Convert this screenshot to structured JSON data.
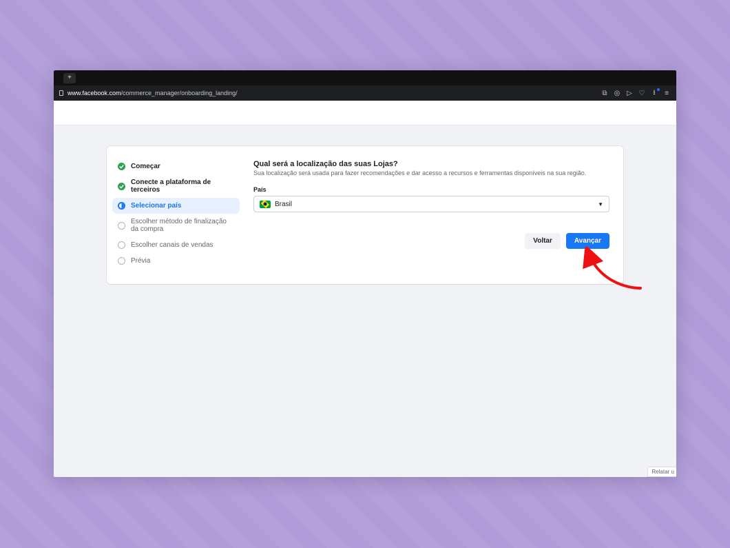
{
  "url": {
    "domain": "www.facebook.com",
    "path": "/commerce_manager/onboarding_landing/"
  },
  "toolbar_icons": [
    "new-tab-icon"
  ],
  "addr_icons": [
    "save-icon",
    "camera-icon",
    "send-icon",
    "heart-icon",
    "download-icon",
    "menu-icon"
  ],
  "steps": [
    {
      "label": "Começar",
      "state": "done"
    },
    {
      "label": "Conecte a plataforma de terceiros",
      "state": "done"
    },
    {
      "label": "Selecionar país",
      "state": "active"
    },
    {
      "label": "Escolher método de finalização da compra",
      "state": "upcoming"
    },
    {
      "label": "Escolher canais de vendas",
      "state": "upcoming"
    },
    {
      "label": "Prévia",
      "state": "upcoming"
    }
  ],
  "heading": "Qual será a localização das suas Lojas?",
  "subheading": "Sua localização será usada para fazer recomendações e dar acesso a recursos e ferramentas disponíveis na sua região.",
  "field": {
    "label": "País",
    "value": "Brasil"
  },
  "buttons": {
    "back": "Voltar",
    "next": "Avançar"
  },
  "feedback": "Relatar u"
}
